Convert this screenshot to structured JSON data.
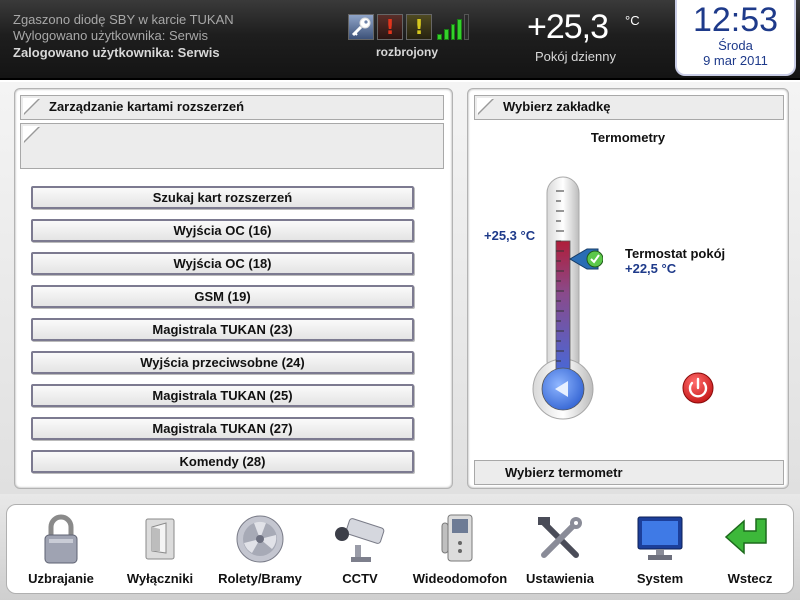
{
  "header": {
    "messages": [
      "Zgaszono diodę SBY w karcie TUKAN",
      "Wylogowano użytkownika: Serwis",
      "Zalogowano użytkownika: Serwis"
    ],
    "status_icons": [
      "key-icon",
      "warning-red-icon",
      "warning-yellow-icon",
      "signal-strength-icon"
    ],
    "exclamation": "!",
    "armed_label": "rozbrojony",
    "temperature": "+25,3",
    "temperature_unit": "°C",
    "room_label": "Pokój dzienny",
    "clock": {
      "time": "12:53",
      "day": "Środa",
      "date": "9 mar 2011"
    }
  },
  "left_panel": {
    "title": "Zarządzanie kartami rozszerzeń",
    "buttons": [
      "Szukaj kart rozszerzeń",
      "Wyjścia OC (16)",
      "Wyjścia OC (18)",
      "GSM (19)",
      "Magistrala TUKAN (23)",
      "Wyjścia przeciwsobne (24)",
      "Magistrala TUKAN (25)",
      "Magistrala TUKAN (27)",
      "Komendy (28)"
    ]
  },
  "right_panel": {
    "title": "Wybierz zakładkę",
    "heading": "Termometry",
    "thermometer_value": "+25,3 °C",
    "thermostat_name": "Termostat pokój",
    "thermostat_value": "+22,5 °C",
    "select_label": "Wybierz termometr",
    "colors": {
      "mercury_red": "#b01e3a",
      "mercury_blue": "#3a6ee8",
      "power_red": "#d61616"
    }
  },
  "toolbar": {
    "items": [
      {
        "label": "Uzbrajanie",
        "icon": "padlock-icon"
      },
      {
        "label": "Wyłączniki",
        "icon": "light-switch-icon"
      },
      {
        "label": "Rolety/Bramy",
        "icon": "fan-vent-icon"
      },
      {
        "label": "CCTV",
        "icon": "cctv-camera-icon"
      },
      {
        "label": "Wideodomofon",
        "icon": "intercom-icon"
      },
      {
        "label": "Ustawienia",
        "icon": "tools-icon"
      },
      {
        "label": "System",
        "icon": "monitor-icon"
      },
      {
        "label": "Wstecz",
        "icon": "back-arrow-icon"
      }
    ]
  }
}
